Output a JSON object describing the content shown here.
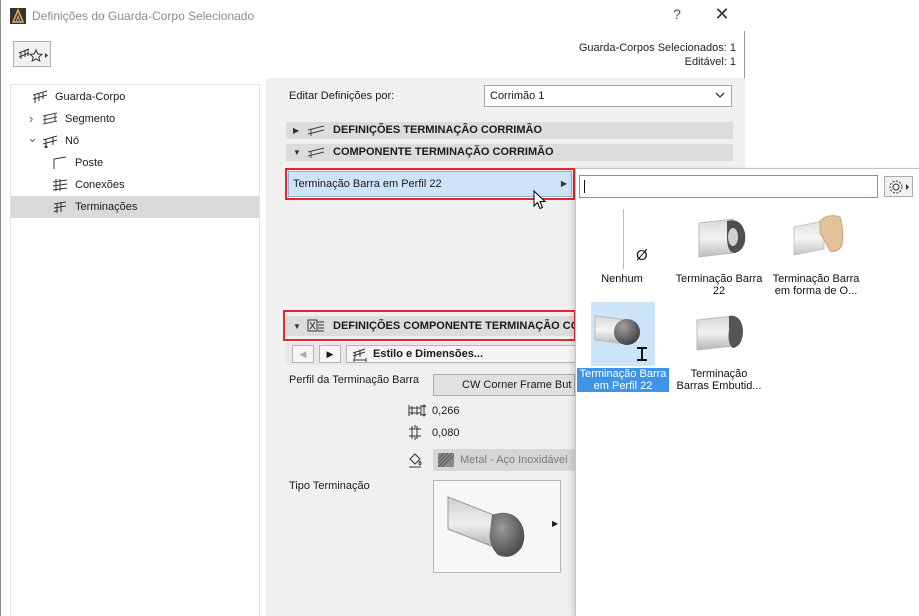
{
  "window": {
    "title": "Definições do Guarda-Corpo Selecionado",
    "help_label": "?",
    "close_label": "✕"
  },
  "selection_info": {
    "line1": "Guarda-Corpos Selecionados: 1",
    "line2": "Editável: 1"
  },
  "tree": {
    "items": [
      {
        "label": "Guarda-Corpo",
        "icon": "railing-icon"
      },
      {
        "label": "Segmento",
        "icon": "segment-icon",
        "expander": "›"
      },
      {
        "label": "Nó",
        "icon": "node-icon",
        "expander": "⌄"
      },
      {
        "label": "Poste",
        "icon": "post-icon"
      },
      {
        "label": "Conexões",
        "icon": "connections-icon"
      },
      {
        "label": "Terminações",
        "icon": "ends-icon",
        "selected": true
      }
    ]
  },
  "panel": {
    "edit_label": "Editar Definições por:",
    "edit_value": "Corrimão 1",
    "section1": "DEFINIÇÕES TERMINAÇÃO CORRIMÃO",
    "section2": "COMPONENTE TERMINAÇÃO CORRIMÃO",
    "term_field": "Terminação Barra em Perfil 22",
    "section3": "DEFINIÇÕES COMPONENTE TERMINAÇÃO COR",
    "style_btn": "Estilo e Dimensões...",
    "profile_label": "Perfil da Terminação Barra",
    "profile_value": "CW Corner Frame But",
    "dim1": "0,266",
    "dim2": "0,080",
    "material_value": "Metal - Aço Inoxidável",
    "type_label": "Tipo Terminação"
  },
  "popup": {
    "search_value": "",
    "tiles": [
      {
        "name_l1": "Nenhum",
        "name_l2": "",
        "symbol": "Ø"
      },
      {
        "name_l1": "Terminação Barra",
        "name_l2": "22"
      },
      {
        "name_l1": "Terminação Barra",
        "name_l2": "em forma de O..."
      },
      {
        "name_l1": "Terminação Barra",
        "name_l2": "em Perfil 22",
        "selected": true
      },
      {
        "name_l1": "Terminação",
        "name_l2": "Barras Embutid..."
      }
    ]
  },
  "colors": {
    "selection_blue": "#3f94e8",
    "highlight_red": "#e8242e",
    "field_blue": "#cde3f7"
  }
}
